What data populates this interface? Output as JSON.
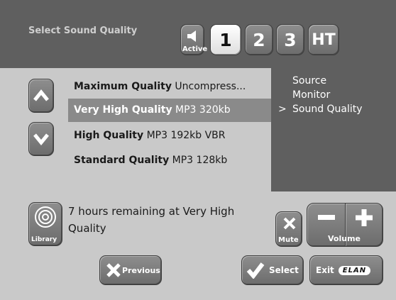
{
  "header": {
    "title": "Select Sound Quality"
  },
  "zones": {
    "active_label": "Active",
    "zone1": "1",
    "zone2": "2",
    "zone3": "3",
    "zone_ht": "HT"
  },
  "quality_list": {
    "items": [
      {
        "name": "Maximum Quality",
        "detail": "Uncompress..."
      },
      {
        "name": "Very High Quality",
        "detail": "MP3 320kb"
      },
      {
        "name": "High Quality",
        "detail": "MP3 192kb VBR"
      },
      {
        "name": "Standard Quality",
        "detail": "MP3 128kb"
      }
    ],
    "selected_index": 1
  },
  "side_menu": {
    "items": [
      "Source",
      "Monitor",
      "Sound Quality"
    ],
    "current_marker": ">"
  },
  "status": {
    "message": "7 hours remaining at Very High Quality"
  },
  "buttons": {
    "library": "Library",
    "mute": "Mute",
    "volume": "Volume",
    "previous": "Previous",
    "select": "Select",
    "exit": "Exit",
    "brand": "ELAN"
  },
  "colors": {
    "background": "#5f5f5f",
    "panel": "#c9c9c9",
    "highlight": "#8a8a8a"
  }
}
